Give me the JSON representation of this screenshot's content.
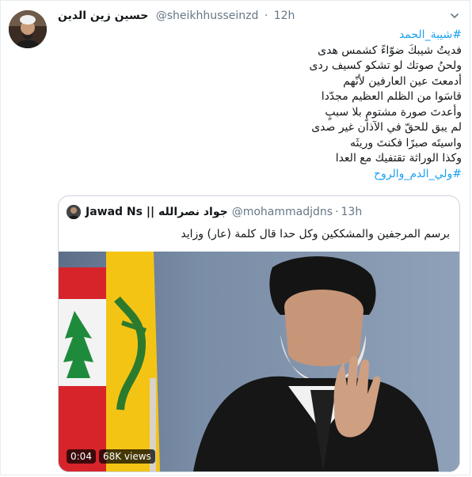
{
  "tweet": {
    "author_name": "حسين زين الدين",
    "handle": "@sheikhhusseinzd",
    "time": "12h",
    "lines": [
      "#شيبة_الحمد",
      "فديتُ شيبكَ ضوّاءً كشمس هدى",
      "ولحنُ صوتك لو تشكو كسيف ردى",
      "أدمعتَ عين العارفين لأنّهم",
      "قاسَوا من الظلم العظيم مجدّدا",
      "وأعدتَ صورة مشتومٍ بلا سببٍ",
      "لم يبق للحقّ في الآذان غير صدى",
      "واسيتَه صبرًا فكنتَ وريثَه",
      "وكذا الوراثة تقتفيك مع العدا",
      "#ولي_الدم_والروح"
    ],
    "menu_icon": "chevron-down-icon"
  },
  "quoted": {
    "author_name": "Jawad Ns || جواد نصرالله",
    "handle": "@mohammadjdns",
    "time": "13h",
    "text": "برسم المرجفين والمشككين وكل حدا قال كلمة (عار) وزايد",
    "video": {
      "duration": "0:04",
      "views": "68K views"
    }
  },
  "colors": {
    "link": "#1da1f2",
    "secondary_text": "#657786",
    "border": "#e6ecf0"
  }
}
